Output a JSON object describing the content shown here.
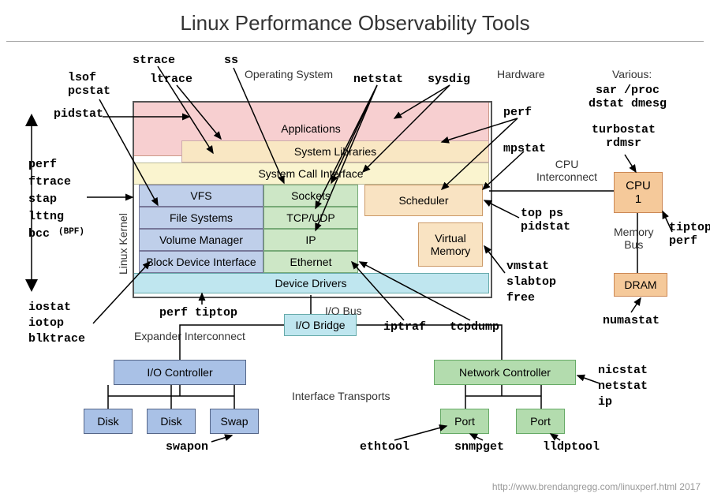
{
  "title": "Linux Performance Observability Tools",
  "headers": {
    "os": "Operating System",
    "hw": "Hardware",
    "various": "Various:"
  },
  "layers": {
    "applications": "Applications",
    "syslib": "System Libraries",
    "syscall": "System Call Interface",
    "vfs": "VFS",
    "filesystems": "File Systems",
    "volmgr": "Volume Manager",
    "blockdev": "Block Device Interface",
    "sockets": "Sockets",
    "tcpudp": "TCP/UDP",
    "ip": "IP",
    "ethernet": "Ethernet",
    "scheduler": "Scheduler",
    "virtmem": "Virtual\nMemory",
    "devdrv": "Device Drivers",
    "iobridge": "I/O Bridge",
    "ioctrl": "I/O Controller",
    "netctrl": "Network Controller",
    "disk": "Disk",
    "swap": "Swap",
    "port": "Port",
    "cpu1": "CPU\n1",
    "dram": "DRAM"
  },
  "bus": {
    "iobus": "I/O Bus",
    "expander": "Expander Interconnect",
    "iftrans": "Interface Transports",
    "cpuinter": "CPU\nInterconnect",
    "membus": "Memory\nBus"
  },
  "kernel_label": "Linux Kernel",
  "tools": {
    "strace": "strace",
    "ltrace": "ltrace",
    "ss": "ss",
    "lsof_pcs": "lsof\npcstat",
    "pidstat": "pidstat",
    "left_stack": "perf\nftrace\nstap\nlttng\nbcc",
    "bpf": "(BPF)",
    "iostat_stack": "iostat\niotop\nblktrace",
    "perf_tiptop": "perf tiptop",
    "swapon": "swapon",
    "netstat": "netstat",
    "sysdig": "sysdig",
    "perf": "perf",
    "mpstat": "mpstat",
    "top_ps": "top ps\npidstat",
    "vmstat_stack": "vmstat\nslabtop\nfree",
    "tiptop_perf": "tiptop\nperf",
    "numastat": "numastat",
    "nicstat_stack": "nicstat\nnetstat\nip",
    "iptraf": "iptraf",
    "tcpdump": "tcpdump",
    "ethtool": "ethtool",
    "snmpget": "snmpget",
    "lldptool": "lldptool",
    "various": "sar /proc\ndstat dmesg",
    "turbo": "turbostat\nrdmsr"
  },
  "credit": "http://www.brendangregg.com/linuxperf.html  2017"
}
